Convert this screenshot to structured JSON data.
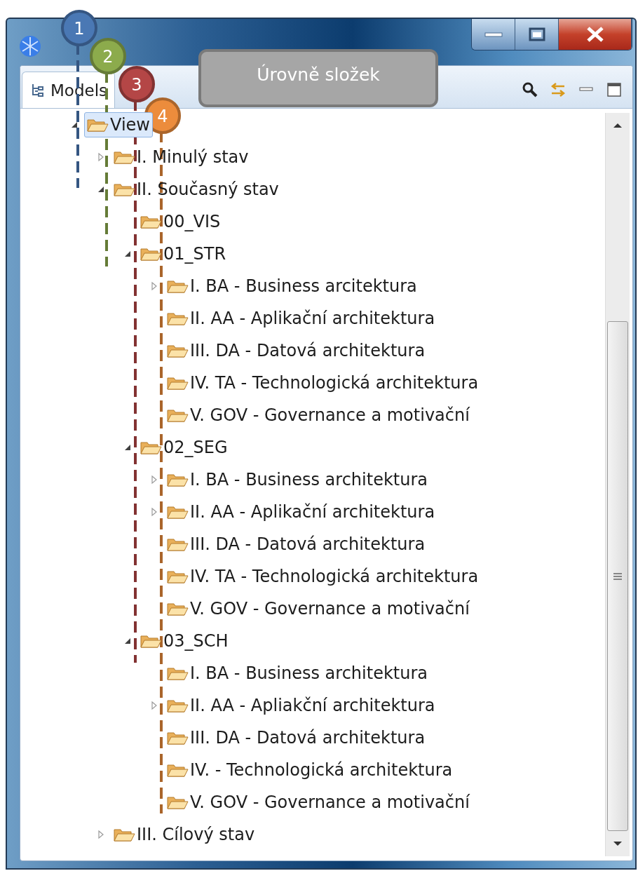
{
  "window": {
    "tab": {
      "label": "Models",
      "selected": true
    }
  },
  "callout": {
    "text": "Úrovně složek"
  },
  "annotations": [
    {
      "label": "1",
      "color": "#4a78b4"
    },
    {
      "label": "2",
      "color": "#8cab4c"
    },
    {
      "label": "3",
      "color": "#b44646"
    },
    {
      "label": "4",
      "color": "#ec8c3c"
    }
  ],
  "tree": [
    {
      "label": "View",
      "expandable": true,
      "expanded": true,
      "selected": true,
      "children": [
        {
          "label": "I. Minulý stav",
          "expandable": true,
          "expanded": false,
          "selected": false
        },
        {
          "label": "II. Současný stav",
          "expandable": true,
          "expanded": true,
          "selected": false,
          "children": [
            {
              "label": "00_VIS",
              "expandable": false,
              "expanded": false,
              "selected": false
            },
            {
              "label": "01_STR",
              "expandable": true,
              "expanded": true,
              "selected": false,
              "children": [
                {
                  "label": "I. BA - Business arcitektura",
                  "expandable": true,
                  "expanded": false,
                  "selected": false
                },
                {
                  "label": "II. AA - Aplikační architektura",
                  "expandable": false,
                  "expanded": false,
                  "selected": false
                },
                {
                  "label": "III. DA - Datová architektura",
                  "expandable": false,
                  "expanded": false,
                  "selected": false
                },
                {
                  "label": "IV. TA - Technologická architektura",
                  "expandable": false,
                  "expanded": false,
                  "selected": false
                },
                {
                  "label": "V. GOV - Governance a motivační",
                  "expandable": false,
                  "expanded": false,
                  "selected": false
                }
              ]
            },
            {
              "label": "02_SEG",
              "expandable": true,
              "expanded": true,
              "selected": false,
              "children": [
                {
                  "label": "I. BA - Business architektura",
                  "expandable": true,
                  "expanded": false,
                  "selected": false
                },
                {
                  "label": "II. AA - Aplikační architektura",
                  "expandable": true,
                  "expanded": false,
                  "selected": false
                },
                {
                  "label": "III. DA - Datová architektura",
                  "expandable": false,
                  "expanded": false,
                  "selected": false
                },
                {
                  "label": "IV. TA - Technologická architektura",
                  "expandable": false,
                  "expanded": false,
                  "selected": false
                },
                {
                  "label": "V. GOV - Governance a motivační",
                  "expandable": false,
                  "expanded": false,
                  "selected": false
                }
              ]
            },
            {
              "label": "03_SCH",
              "expandable": true,
              "expanded": true,
              "selected": false,
              "children": [
                {
                  "label": "I. BA - Business architektura",
                  "expandable": false,
                  "expanded": false,
                  "selected": false
                },
                {
                  "label": "II. AA - Apliakční architektura",
                  "expandable": true,
                  "expanded": false,
                  "selected": false
                },
                {
                  "label": "III. DA - Datová architektura",
                  "expandable": false,
                  "expanded": false,
                  "selected": false
                },
                {
                  "label": "IV. - Technologická architektura",
                  "expandable": false,
                  "expanded": false,
                  "selected": false
                },
                {
                  "label": "V. GOV - Governance a motivační",
                  "expandable": false,
                  "expanded": false,
                  "selected": false
                }
              ]
            }
          ]
        },
        {
          "label": "III. Cílový stav",
          "expandable": true,
          "expanded": false,
          "selected": false
        }
      ]
    }
  ]
}
